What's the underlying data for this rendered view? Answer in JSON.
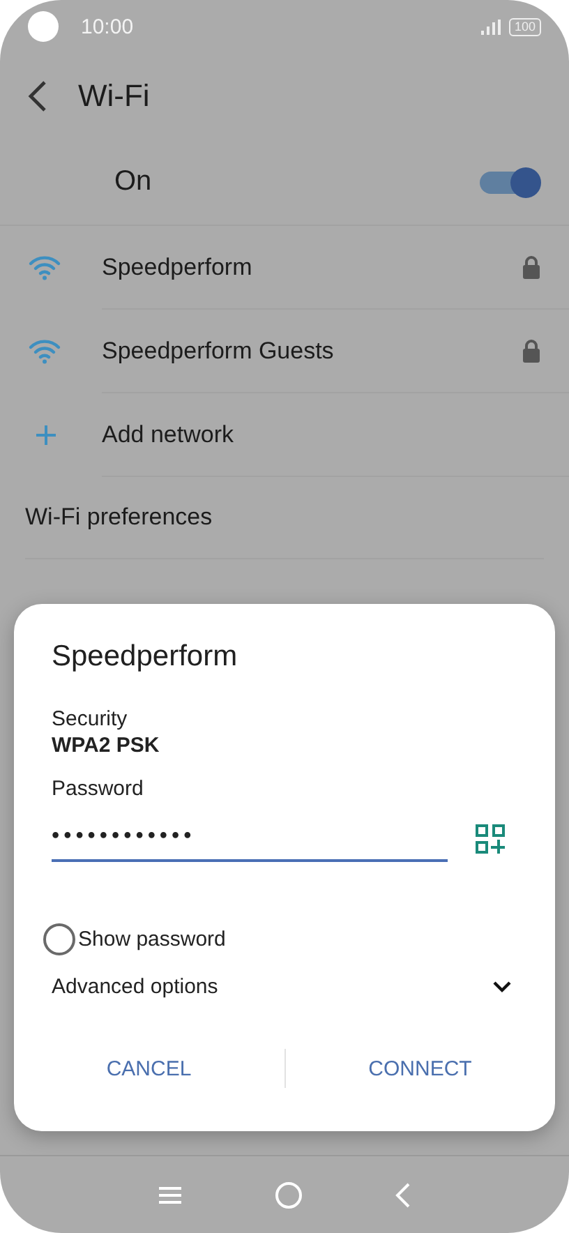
{
  "status_bar": {
    "time": "10:00",
    "battery": "100"
  },
  "header": {
    "title": "Wi-Fi"
  },
  "master_switch": {
    "label": "On",
    "on": true
  },
  "networks": [
    {
      "kind": "wifi",
      "name": "Speedperform",
      "locked": true
    },
    {
      "kind": "wifi",
      "name": "Speedperform Guests",
      "locked": true
    },
    {
      "kind": "add",
      "name": "Add network"
    }
  ],
  "menu_items": [
    "Wi-Fi preferences"
  ],
  "dialog": {
    "title": "Speedperform",
    "security_label": "Security",
    "security_value": "WPA2 PSK",
    "password_label": "Password",
    "password_value": "••••••••••••",
    "show_password": {
      "label": "Show password",
      "checked": false
    },
    "advanced_options": {
      "label": "Advanced options",
      "expanded": false
    },
    "buttons": [
      "CANCEL",
      "CONNECT"
    ]
  }
}
